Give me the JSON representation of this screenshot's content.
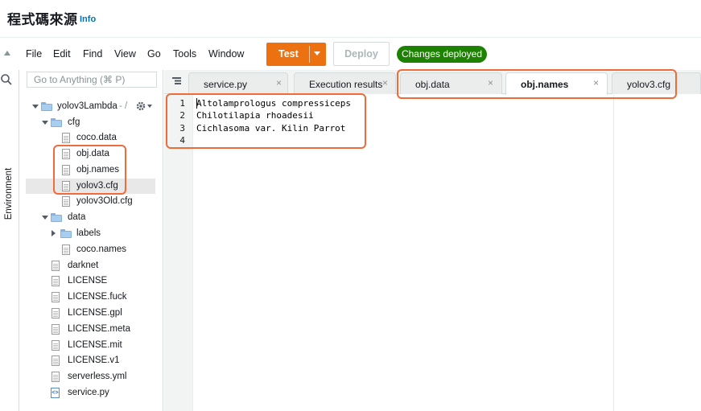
{
  "header": {
    "title": "程式碼來源",
    "info": "Info"
  },
  "menu": {
    "items": [
      "File",
      "Edit",
      "Find",
      "View",
      "Go",
      "Tools",
      "Window"
    ],
    "test_label": "Test",
    "deploy_label": "Deploy",
    "status_badge": "Changes deployed"
  },
  "sidebar": {
    "environment_label": "Environment"
  },
  "file_tree": {
    "search_placeholder": "Go to Anything (⌘ P)",
    "root": "yolov3Lambda",
    "root_path_hint": "- /",
    "cfg_folder": "cfg",
    "cfg_files": [
      "coco.data",
      "obj.data",
      "obj.names",
      "yolov3.cfg",
      "yolov3Old.cfg"
    ],
    "data_folder": "data",
    "labels_folder": "labels",
    "data_files": [
      "coco.names"
    ],
    "root_files": [
      "darknet",
      "LICENSE",
      "LICENSE.fuck",
      "LICENSE.gpl",
      "LICENSE.meta",
      "LICENSE.mit",
      "LICENSE.v1",
      "serverless.yml",
      "service.py"
    ]
  },
  "tabs": [
    {
      "label": "service.py",
      "active": false
    },
    {
      "label": "Execution results",
      "active": false
    },
    {
      "label": "obj.data",
      "active": false
    },
    {
      "label": "obj.names",
      "active": true
    },
    {
      "label": "yolov3.cfg",
      "active": false
    }
  ],
  "editor": {
    "line_numbers": [
      "1",
      "2",
      "3",
      "4"
    ],
    "lines": [
      "Altolamprologus compressiceps",
      "Chilotilapia rhoadesii",
      "Cichlasoma var. Kilin Parrot",
      ""
    ]
  },
  "colors": {
    "accent": "#ec7211",
    "success": "#1d8102",
    "highlight": "#ef6b3a",
    "link": "#0073bb"
  }
}
